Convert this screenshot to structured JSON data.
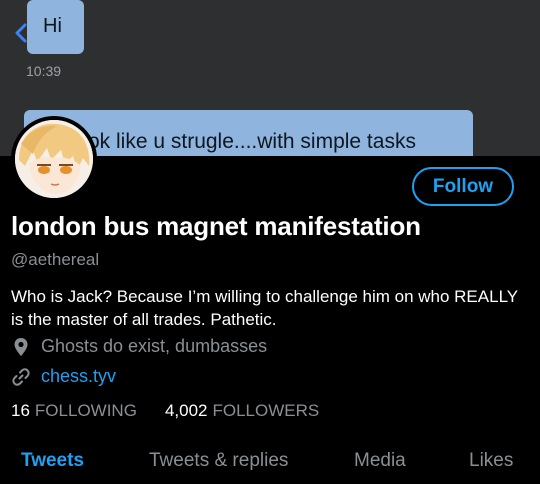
{
  "banner": {
    "bubble_hi": "Hi",
    "time": "10:39",
    "bubble_message": "ok like u strugle....with simple tasks"
  },
  "profile": {
    "follow_label": "Follow",
    "display_name": "london bus magnet manifestation",
    "handle": "@aethereal",
    "bio": "Who is Jack? Because I’m willing to challenge him on who REALLY is the master of all trades. Pathetic.",
    "location": "Ghosts do exist, dumbasses",
    "website": "chess.tyv"
  },
  "stats": {
    "following_count": "16",
    "following_label": "FOLLOWING",
    "followers_count": "4,002",
    "followers_label": "FOLLOWERS"
  },
  "tabs": [
    {
      "label": "Tweets",
      "active": true
    },
    {
      "label": "Tweets & replies",
      "active": false
    },
    {
      "label": "Media",
      "active": false
    },
    {
      "label": "Likes",
      "active": false
    }
  ],
  "colors": {
    "accent": "#1da1f2",
    "background": "#000000",
    "muted_text": "#8a8f94",
    "chat_bubble": "#8fb5df"
  },
  "icons": {
    "back": "chevron-left-icon",
    "location": "map-pin-icon",
    "website": "link-icon"
  }
}
